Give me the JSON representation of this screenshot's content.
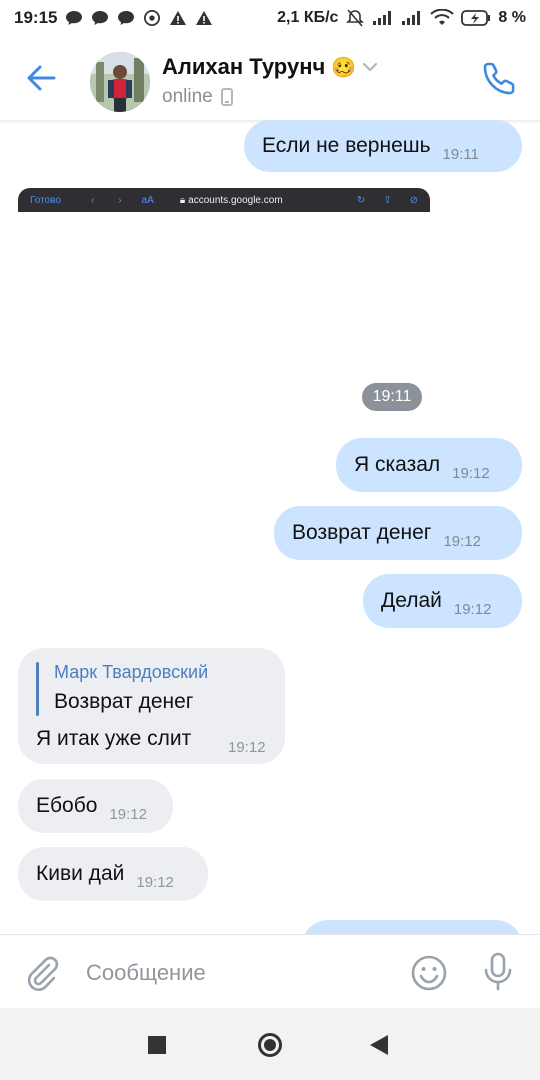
{
  "status_bar": {
    "time": "19:15",
    "net_speed": "2,1 КБ/с",
    "battery": "8 %"
  },
  "header": {
    "contact_name": "Алихан Турунч",
    "contact_emoji": "🥴",
    "status": "online"
  },
  "browser_preview": {
    "done_label": "Готово",
    "url": "accounts.google.com",
    "text_size": "аА"
  },
  "messages": [
    {
      "id": "m1",
      "direction": "out",
      "text": "Если не вернешь",
      "time": "19:11"
    },
    {
      "id": "m2",
      "direction": "out",
      "text": "Я сказал",
      "time": "19:12"
    },
    {
      "id": "m3",
      "direction": "out",
      "text": "Возврат денег",
      "time": "19:12"
    },
    {
      "id": "m4",
      "direction": "out",
      "text": "Делай",
      "time": "19:12"
    },
    {
      "id": "m5",
      "direction": "in",
      "text": "Я итак уже слит",
      "time": "19:12",
      "reply": {
        "author": "Марк Твардовский",
        "text": "Возврат денег"
      }
    },
    {
      "id": "m6",
      "direction": "in",
      "text": "Ебобо",
      "time": "19:12"
    },
    {
      "id": "m7",
      "direction": "in",
      "text": "Киви дай",
      "time": "19:12"
    }
  ],
  "date_pill": "19:11",
  "composer": {
    "placeholder": "Сообщение"
  },
  "icons": {
    "back": "arrow-left-icon",
    "call": "phone-icon",
    "attach": "paperclip-icon",
    "emoji": "smile-icon",
    "mic": "microphone-icon",
    "nav_recent": "square-icon",
    "nav_home": "circle-icon",
    "nav_back": "triangle-back-icon"
  },
  "colors": {
    "accent": "#3f8ae0",
    "outgoing_bubble": "#cce4ff",
    "incoming_bubble": "#eceef2",
    "reply_author": "#4a7fbf"
  }
}
